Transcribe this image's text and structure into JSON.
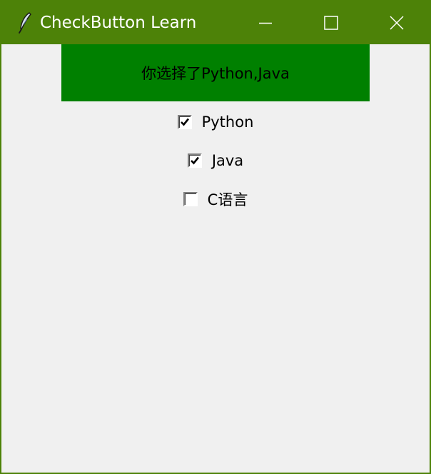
{
  "window": {
    "title": "CheckButton Learn",
    "titlebar_color": "#4d8208",
    "app_icon": "feather-icon",
    "controls": {
      "minimize_icon": "minimize-icon",
      "maximize_icon": "maximize-icon",
      "close_icon": "close-icon"
    }
  },
  "result": {
    "text": "你选择了Python,Java",
    "background": "#008000"
  },
  "checkbuttons": [
    {
      "label": "Python",
      "checked": true
    },
    {
      "label": "Java",
      "checked": true
    },
    {
      "label": "C语言",
      "checked": false
    }
  ]
}
